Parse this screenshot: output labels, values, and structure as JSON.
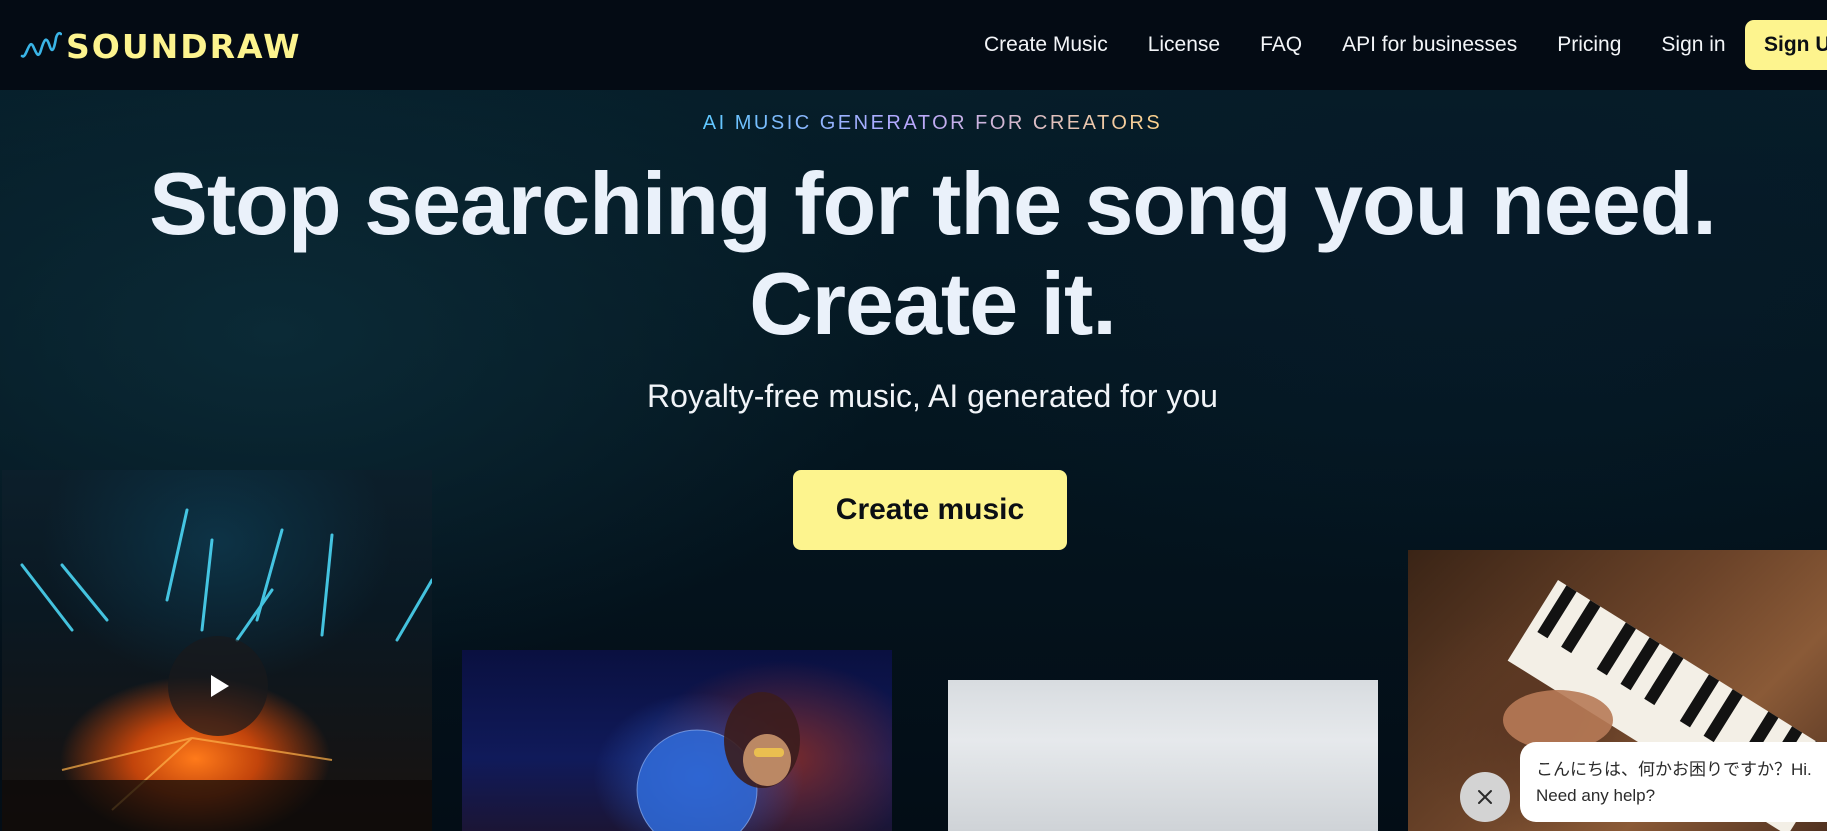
{
  "header": {
    "logo_text": "SOUNDRAW",
    "nav": [
      "Create Music",
      "License",
      "FAQ",
      "API for businesses",
      "Pricing",
      "Sign in"
    ],
    "signup_label": "Sign Up"
  },
  "hero": {
    "eyebrow": "AI MUSIC GENERATOR FOR CREATORS",
    "headline_line1": "Stop searching for the song you need.",
    "headline_line2": "Create it.",
    "subhead": "Royalty-free music, AI generated for you",
    "cta_label": "Create music"
  },
  "chat": {
    "line1": "こんにちは、何かお困りですか？Hi.",
    "line2": "Need any help?"
  },
  "colors": {
    "brand_yellow": "#fdf48e",
    "header_bg": "#040b14",
    "page_bg": "#04111c"
  },
  "icons": {
    "logo": "waveform-icon",
    "play": "play-icon",
    "close": "close-icon"
  }
}
